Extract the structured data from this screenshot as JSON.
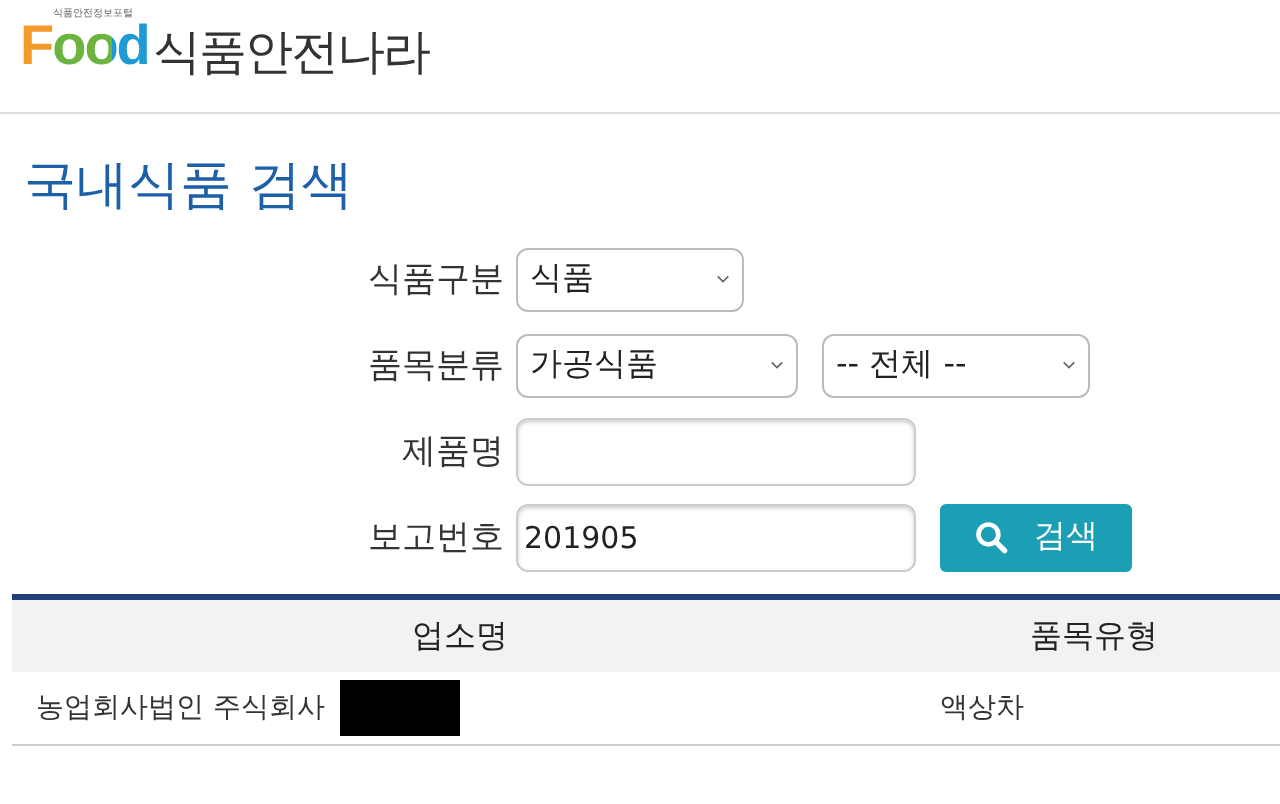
{
  "header": {
    "logo_tagline": "식품안전정보포털",
    "logo_word": "Food",
    "site_name": "식품안전나라"
  },
  "page_title": "국내식품 검색",
  "form": {
    "rows": [
      {
        "label": "식품구분",
        "fields": [
          {
            "kind": "select",
            "value": "식품"
          }
        ]
      },
      {
        "label": "품목분류",
        "fields": [
          {
            "kind": "select",
            "value": "가공식품"
          },
          {
            "kind": "select",
            "value": "-- 전체 --"
          }
        ]
      },
      {
        "label": "제품명",
        "fields": [
          {
            "kind": "input"
          }
        ]
      },
      {
        "label": "보고번호",
        "fields": [
          {
            "kind": "input",
            "value": "201905"
          },
          {
            "kind": "button",
            "value": "검색"
          }
        ]
      }
    ]
  },
  "table": {
    "columns": [
      "업소명",
      "품목유형"
    ],
    "rows": [
      {
        "cells": [
          "농업회사법인 주식회사",
          "액상차"
        ],
        "redacted": true
      }
    ]
  }
}
